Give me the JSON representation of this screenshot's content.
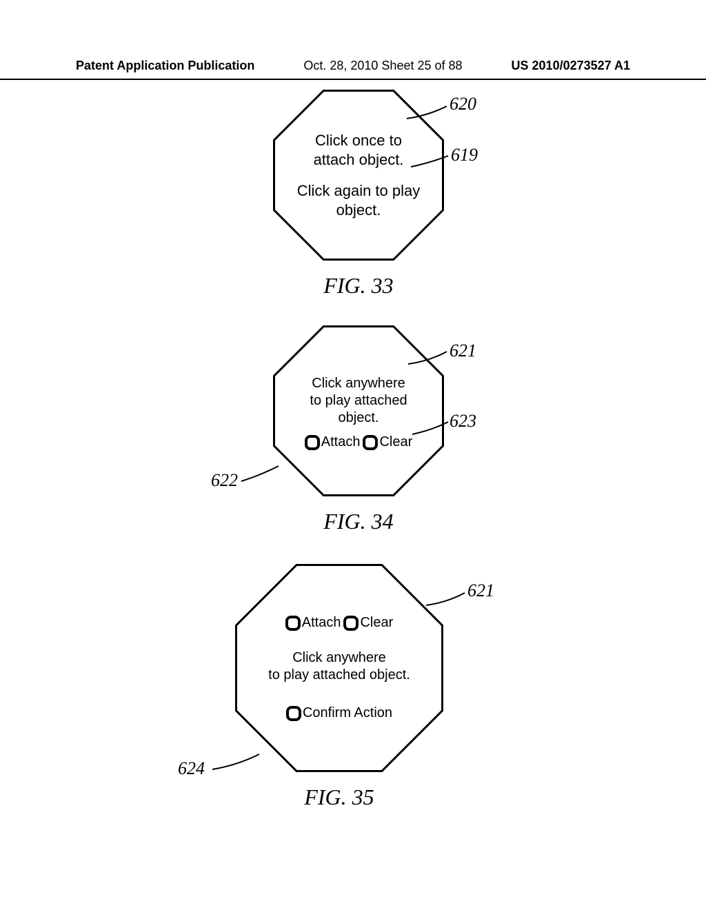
{
  "header": {
    "left": "Patent Application Publication",
    "mid": "Oct. 28, 2010  Sheet 25 of 88",
    "right": "US 2010/0273527 A1"
  },
  "fig33": {
    "caption": "FIG. 33",
    "line1": "Click once to",
    "line2": "attach object.",
    "line3": "Click again to play",
    "line4": "object.",
    "ref_620": "620",
    "ref_619": "619"
  },
  "fig34": {
    "caption": "FIG. 34",
    "line1": "Click anywhere",
    "line2": "to play attached",
    "line3": "object.",
    "attach_label": "Attach",
    "clear_label": "Clear",
    "ref_621": "621",
    "ref_623": "623",
    "ref_622": "622"
  },
  "fig35": {
    "caption": "FIG. 35",
    "attach_label": "Attach",
    "clear_label": "Clear",
    "line1": "Click anywhere",
    "line2": "to play attached object.",
    "confirm_label": "Confirm Action",
    "ref_621": "621",
    "ref_624": "624"
  }
}
